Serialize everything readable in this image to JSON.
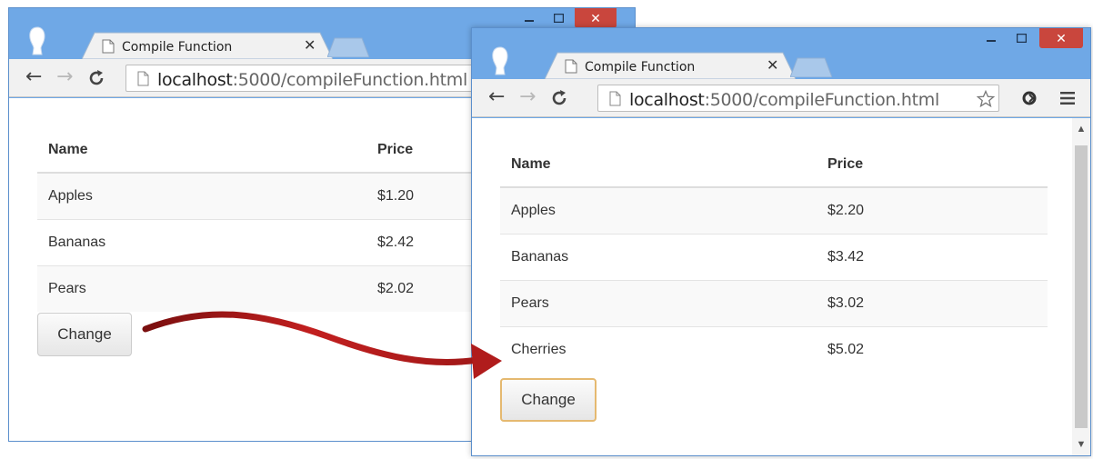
{
  "windows": [
    {
      "tab_title": "Compile Function",
      "url_host": "localhost",
      "url_path": ":5000/compileFunction.html",
      "table": {
        "headers": [
          "Name",
          "Price"
        ],
        "rows": [
          {
            "name": "Apples",
            "price": "$1.20"
          },
          {
            "name": "Bananas",
            "price": "$2.42"
          },
          {
            "name": "Pears",
            "price": "$2.02"
          }
        ]
      },
      "button_label": "Change"
    },
    {
      "tab_title": "Compile Function",
      "url_host": "localhost",
      "url_path": ":5000/compileFunction.html",
      "table": {
        "headers": [
          "Name",
          "Price"
        ],
        "rows": [
          {
            "name": "Apples",
            "price": "$2.20"
          },
          {
            "name": "Bananas",
            "price": "$3.42"
          },
          {
            "name": "Pears",
            "price": "$3.02"
          },
          {
            "name": "Cherries",
            "price": "$5.02"
          }
        ]
      },
      "button_label": "Change"
    }
  ],
  "icons": {
    "back": "arrow-left",
    "forward": "arrow-right",
    "reload": "reload",
    "page": "page",
    "star": "star",
    "extension": "extension",
    "menu": "hamburger-menu",
    "minimize": "minimize",
    "maximize": "maximize",
    "close": "close"
  },
  "colors": {
    "window_frame": "#6fa8e6",
    "close_button": "#c9463d",
    "arrow": "#b01c1c",
    "focused_button_border": "#e5b970"
  }
}
